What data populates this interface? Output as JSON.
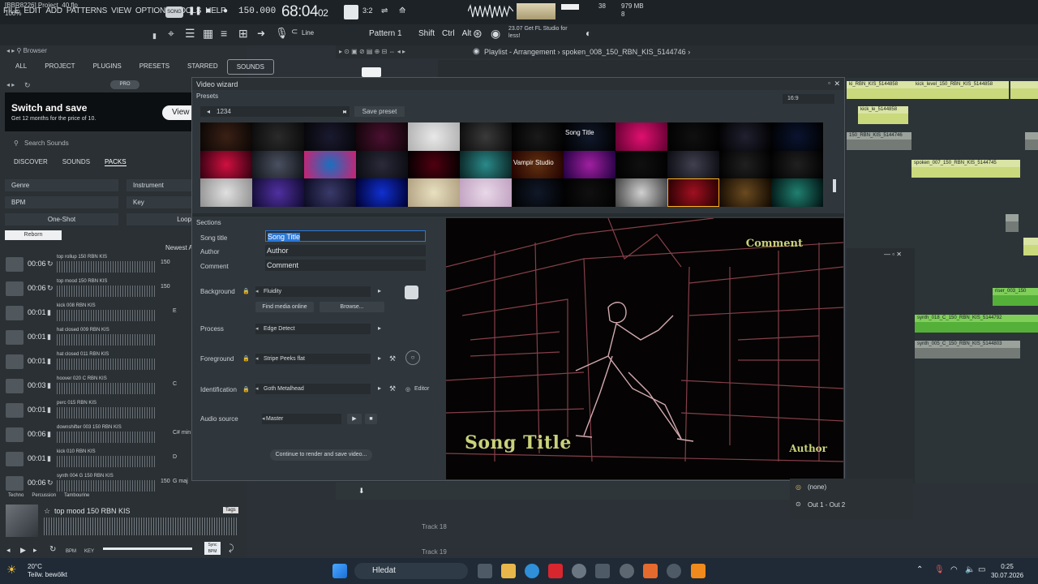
{
  "menu": [
    "FILE",
    "EDIT",
    "ADD",
    "PATTERNS",
    "VIEW",
    "OPTIONS",
    "TOOLS",
    "HELP"
  ],
  "song_badge": "SONG",
  "tempo": "150.000",
  "timer": {
    "main": "68:04",
    "sub": "02"
  },
  "cpu": "38",
  "memory": {
    "value": "979 MB",
    "count": "8"
  },
  "project": {
    "name": "[BBR8226] Project_40.flp",
    "zoom": "100%"
  },
  "snap": "Line",
  "pattern": "Pattern 1",
  "shortcuts": [
    "Shift",
    "Ctrl",
    "Alt"
  ],
  "news": {
    "date": "23.07",
    "text": "Get FL Studio for",
    "text2": "less!"
  },
  "browser": {
    "header": "Browser",
    "tabs": [
      "ALL",
      "PROJECT",
      "PLUGINS",
      "PRESETS",
      "STARRED",
      "SOUNDS"
    ],
    "pro_badge": "PRO",
    "ad_title": "Switch and save",
    "ad_sub": "Get 12 months for the price of 10.",
    "ad_button": "View",
    "search_placeholder": "Search Sounds",
    "sub_tabs": [
      "DISCOVER",
      "SOUNDS",
      "PACKS"
    ],
    "filters": {
      "genre": "Genre",
      "instrument": "Instrument",
      "bpm": "BPM",
      "key": "Key",
      "oneshot": "One-Shot",
      "loop": "Loop"
    },
    "reborn": "Reborn",
    "sort": "Newest A",
    "samples": [
      {
        "time": "00:06",
        "name": "top rollup 150 RBN KIS",
        "bpm": "150",
        "key": ""
      },
      {
        "time": "00:06",
        "name": "top mood 150 RBN KIS",
        "bpm": "150",
        "key": ""
      },
      {
        "time": "00:01",
        "name": "kick 008 RBN KIS",
        "bpm": "",
        "key": "E"
      },
      {
        "time": "00:01",
        "name": "hat closed 009 RBN KIS",
        "bpm": "",
        "key": ""
      },
      {
        "time": "00:01",
        "name": "hat closed 011 RBN KIS",
        "bpm": "",
        "key": ""
      },
      {
        "time": "00:03",
        "name": "hoover 020 C RBN KIS",
        "bpm": "",
        "key": "C"
      },
      {
        "time": "00:01",
        "name": "perc 015 RBN KIS",
        "bpm": "",
        "key": ""
      },
      {
        "time": "00:06",
        "name": "downshifter 003 150 RBN KIS",
        "bpm": "",
        "key": "C# min"
      },
      {
        "time": "00:01",
        "name": "kick 010 RBN KIS",
        "bpm": "",
        "key": "D"
      },
      {
        "time": "00:06",
        "name": "synth 004 G 150 RBN KIS",
        "bpm": "150",
        "key": "G maj"
      }
    ],
    "tags": [
      "Techno",
      "Percussion",
      "Tambourine"
    ],
    "player": {
      "name": "top mood 150 RBN KIS",
      "tag": "Tags",
      "bpm_label": "BPM",
      "key_label": "KEY",
      "sync_label": "Sync BPM"
    }
  },
  "playlist": {
    "title": "Playlist - Arrangement",
    "sample": "spoken_008_150_RBN_KIS_5144746"
  },
  "clips": [
    {
      "label": "kick_level_150_RBN_KIS_5144858",
      "color": "yellow"
    },
    {
      "label": "ki_RBN_KIS_5144858",
      "color": "yellow"
    },
    {
      "label": "kick_le_5144858",
      "color": "yellow"
    },
    {
      "label": "150_RBN_KIS_5144746",
      "color": "gray"
    },
    {
      "label": "spoken_007_150_RBN_KIS_5144745",
      "color": "yellow"
    },
    {
      "label": "riser_003_150",
      "color": "green"
    },
    {
      "label": "synth_018_C_150_RBN_KIS_5144792",
      "color": "green"
    },
    {
      "label": "synth_005_C_150_RBN_KIS_5144803",
      "color": "gray"
    }
  ],
  "wizard": {
    "title": "Video wizard",
    "presets_label": "Presets",
    "preset_name": "1234",
    "save_preset": "Save preset",
    "ratio": "16:9",
    "thumb_captions": [
      "Song Title",
      "Vampir Studio"
    ],
    "sections_label": "Sections",
    "song_title_label": "Song title",
    "song_title_value": "Song Title",
    "author_label": "Author",
    "author_value": "Author",
    "comment_label": "Comment",
    "comment_value": "Comment",
    "background_label": "Background",
    "background_value": "Fluidity",
    "find_media": "Find media online",
    "browse": "Browse...",
    "process_label": "Process",
    "process_value": "Edge Detect",
    "foreground_label": "Foreground",
    "foreground_value": "Stripe Peeks flat",
    "identification_label": "Identification",
    "identification_value": "Goth Metalhead",
    "editor": "Editor",
    "audio_label": "Audio source",
    "audio_value": "Master",
    "continue": "Continue to render and save video...",
    "preview": {
      "comment": "Comment",
      "title": "Song Title",
      "author": "Author"
    }
  },
  "mixer": {
    "none": "(none)",
    "out": "Out 1 - Out 2"
  },
  "tracks": [
    "Track 18",
    "Track 19"
  ],
  "taskbar": {
    "weather_temp": "20°C",
    "weather_desc": "Teilw. bewölkt",
    "search": "Hledat",
    "time": "0:25",
    "date": "30.07.2026"
  }
}
